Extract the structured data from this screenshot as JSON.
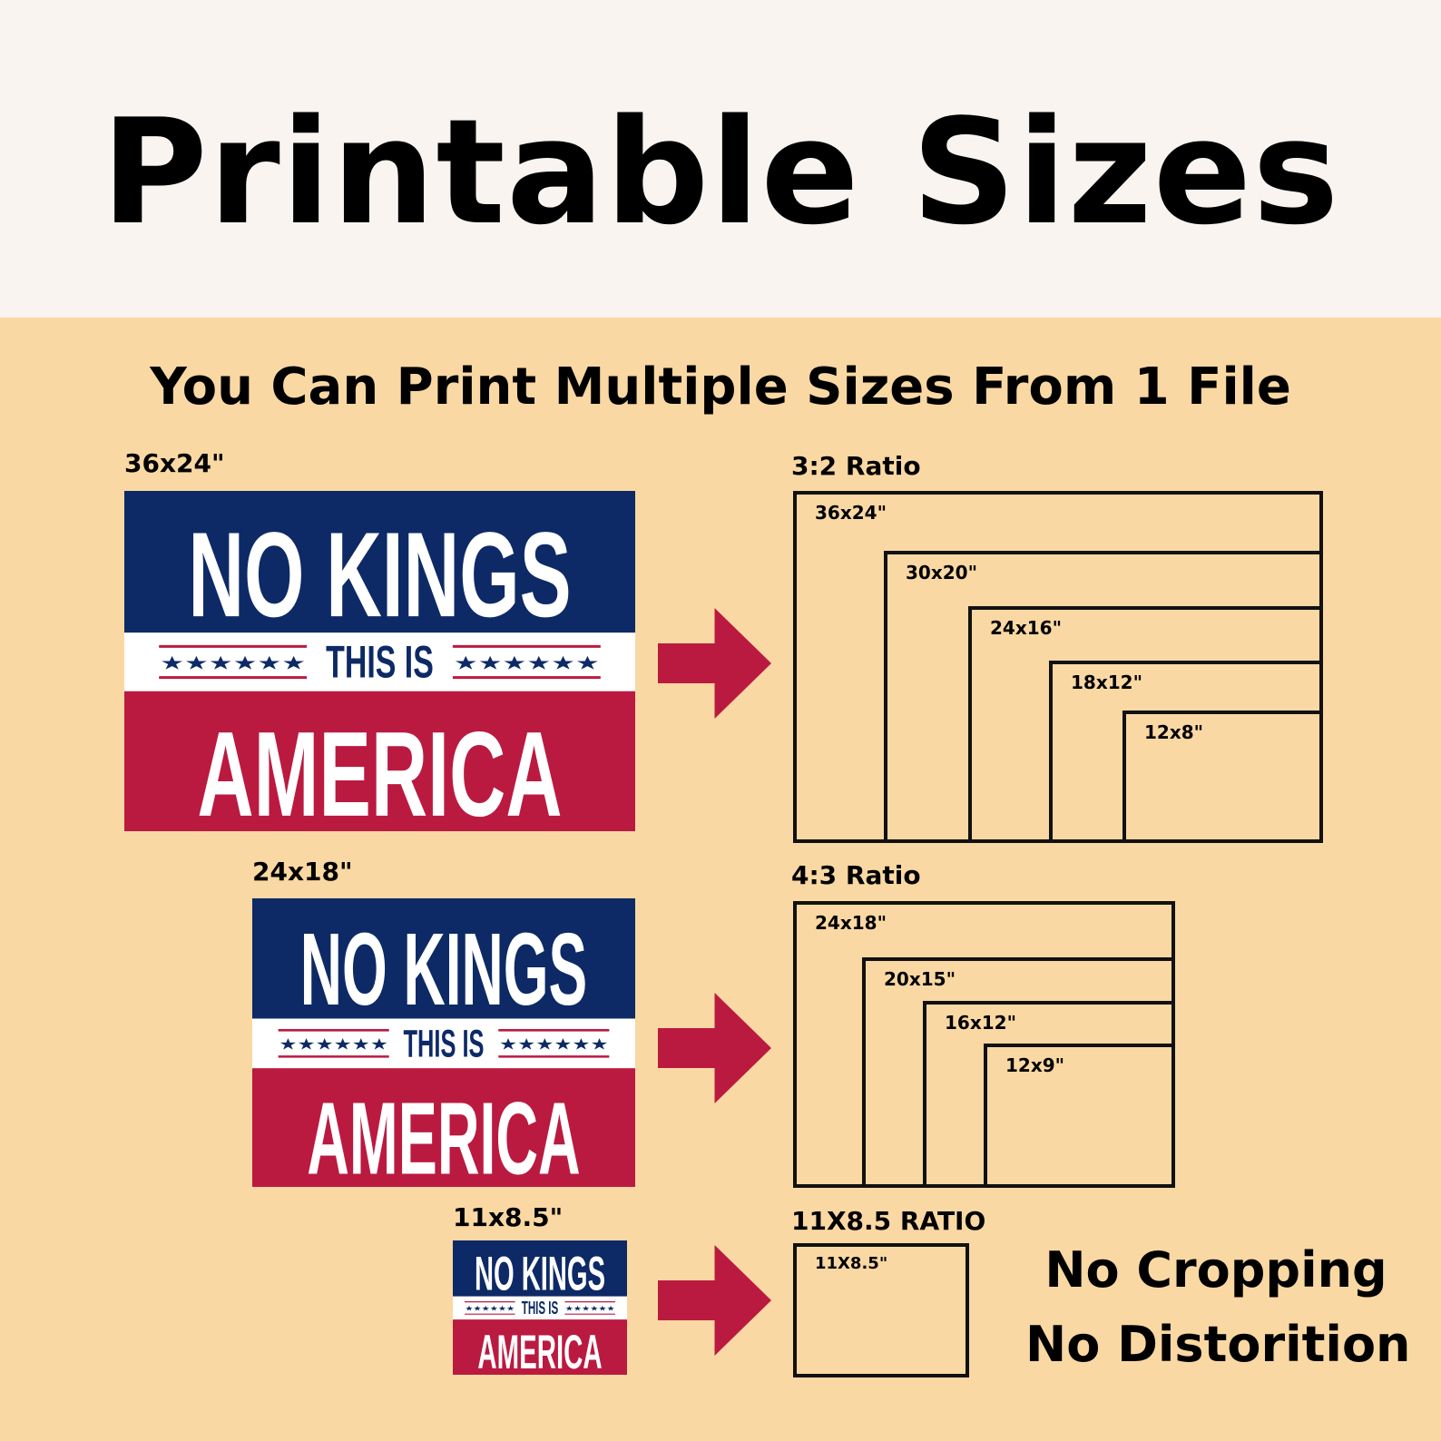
{
  "colors": {
    "top_background": "#f9f4ef",
    "bottom_background": "#fad8a3",
    "navy": "#0d2a66",
    "red": "#bb1a40",
    "white": "#ffffff",
    "arrow": "#bb1a40"
  },
  "header": {
    "title": "Printable Sizes"
  },
  "subtitle": "You Can Print Multiple Sizes From 1 File",
  "poster": {
    "line1": "NO KINGS",
    "line2": "THIS IS",
    "line3": "AMERICA",
    "stars": "★★★★★★"
  },
  "rows": [
    {
      "poster_size": "36x24\"",
      "ratio_label": "3:2 Ratio",
      "sizes": [
        "36x24\"",
        "30x20\"",
        "24x16\"",
        "18x12\"",
        "12x8\""
      ]
    },
    {
      "poster_size": "24x18\"",
      "ratio_label": "4:3 Ratio",
      "sizes": [
        "24x18\"",
        "20x15\"",
        "16x12\"",
        "12x9\""
      ]
    },
    {
      "poster_size": "11x8.5\"",
      "ratio_label": "11X8.5 RATIO",
      "sizes": [
        "11X8.5\""
      ]
    }
  ],
  "tagline": {
    "line1": "No Cropping",
    "line2": "No Distorition"
  },
  "icons": {
    "arrow": "right-arrow-icon",
    "star": "star-icon"
  }
}
